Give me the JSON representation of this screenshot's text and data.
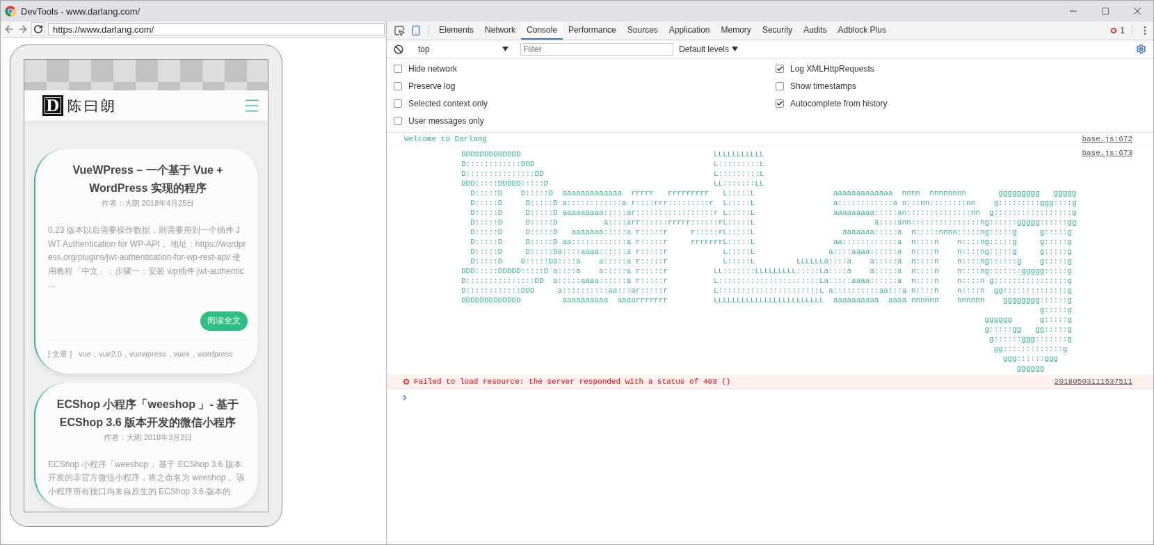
{
  "window": {
    "title": "DevTools - www.darlang.com/"
  },
  "browser": {
    "url": "https://www.darlang.com/"
  },
  "site": {
    "logo_mark": "D",
    "logo_text": "陈曰朗",
    "posts": [
      {
        "title": "VueWPress – 一个基于 Vue + WordPress 实现的程序",
        "meta": "作者：大朗 2018年4月25日",
        "excerpt": "0.23 版本以后需要操作数据，则需要用到一个插件 JWT Authentication for WP-API 。地址：https://wordpress.org/plugins/jwt-authentication-for-wp-rest-api/   使用教程「中文」：步骤一：安装 wp插件 jwt-authentic ...",
        "button": "阅读全文",
        "category": "[ 文章 ]",
        "tags": "vue，vue2.0，vuewpress，vuex，wordpress"
      },
      {
        "title": "ECShop 小程序「weeshop 」- 基于 ECShop 3.6 版本开发的微信小程序",
        "meta": "作者：大朗 2018年3月2日",
        "excerpt": "ECShop 小程序「weeshop 」基于 ECShop 3.6 版本开发的非官方微信小程序，将之命名为 weeshop 。该小程序所有接口均来自原生的 ECShop 3.6 版本的"
      }
    ]
  },
  "devtools": {
    "tabs": [
      {
        "label": "Elements",
        "selected": false
      },
      {
        "label": "Network",
        "selected": false
      },
      {
        "label": "Console",
        "selected": true
      },
      {
        "label": "Performance",
        "selected": false
      },
      {
        "label": "Sources",
        "selected": false
      },
      {
        "label": "Application",
        "selected": false
      },
      {
        "label": "Memory",
        "selected": false
      },
      {
        "label": "Security",
        "selected": false
      },
      {
        "label": "Audits",
        "selected": false
      },
      {
        "label": "Adblock Plus",
        "selected": false
      }
    ],
    "error_count": "1",
    "toolbar": {
      "context": "top",
      "filter_placeholder": "Filter",
      "levels": "Default levels"
    },
    "settings": [
      {
        "label": "Hide network",
        "checked": false
      },
      {
        "label": "Log XMLHttpRequests",
        "checked": true
      },
      {
        "label": "Preserve log",
        "checked": false
      },
      {
        "label": "Show timestamps",
        "checked": false
      },
      {
        "label": "Selected context only",
        "checked": false
      },
      {
        "label": "Autocomplete from history",
        "checked": true
      },
      {
        "label": "User messages only",
        "checked": false
      }
    ],
    "messages": [
      {
        "kind": "log",
        "text": "Welcome to Darlang",
        "source": "base.js:672"
      },
      {
        "kind": "art",
        "source": "base.js:673",
        "lines": [
          "DDDDDDDDDDDDD                                          LLLLLLLLLLL",
          "D::::::::::::DDD                                       L:::::::::L",
          "D:::::::::::::::DD                                     L:::::::::L",
          "DDD:::::DDDDD:::::D                                    LL:::::::LL",
          "  D:::::D    D:::::D  aaaaaaaaaaaaa  rrrrr   rrrrrrrrr   L:::::L                 aaaaaaaaaaaaa  nnnn  nnnnnnnn       ggggggggg   ggggg",
          "  D:::::D     D:::::D a::::::::::::a r::::rrr:::::::::r  L:::::L                 a::::::::::::a n:::nn::::::::nn    g:::::::::ggg::::g",
          "  D:::::D     D:::::D aaaaaaaaa:::::ar:::::::::::::::::r L:::::L                 aaaaaaaaa:::::an::::::::::::::nn  g:::::::::::::::::g",
          "  D:::::D     D:::::D          a::::arr::::::rrrrr::::::rL:::::L                          a::::ann:::::::::::::::ng::::::ggggg::::::gg",
          "  D:::::D     D:::::D   aaaaaaa:::::a r:::::r     r:::::rL:::::L                   aaaaaaa:::::a  n:::::nnnn:::::ng:::::g     g:::::g",
          "  D:::::D     D:::::D aa::::::::::::a r:::::r     rrrrrrrL:::::L                 aa::::::::::::a  n::::n    n::::ng:::::g     g:::::g",
          "  D:::::D     D:::::Da::::aaaa::::::a r:::::r            L:::::L                a::::aaaa::::::a  n::::n    n::::ng:::::g     g:::::g",
          "  D:::::D    D:::::Da::::a    a:::::a r:::::r            L:::::L         LLLLLLa::::a    a:::::a  n::::n    n::::ng::::::g    g:::::g",
          "DDD:::::DDDDD:::::D a::::a    a:::::a r:::::r          LL:::::::LLLLLLLLL:::::La::::a    a:::::a  n::::n    n::::ng:::::::ggggg:::::g",
          "D:::::::::::::::DD  a:::::aaaa::::::a r:::::r          L::::::::::::::::::::::La:::::aaaa::::::a  n::::n    n::::n g::::::::::::::::g",
          "D::::::::::::DDD     a::::::::::aa:::ar:::::r          L::::::::::::::::::::::L a::::::::::aa:::a n::::n    n::::n  gg::::::::::::::g",
          "DDDDDDDDDDDDD         aaaaaaaaaa  aaaarrrrrrr          LLLLLLLLLLLLLLLLLLLLLLLL  aaaaaaaaaa  aaaa nnnnnn    nnnnnn    gggggggg::::::g",
          "                                                                                                                              g:::::g",
          "                                                                                                                  gggggg      g:::::g",
          "                                                                                                                  g:::::gg   gg:::::g",
          "                                                                                                                   g::::::ggg:::::::g",
          "                                                                                                                    gg:::::::::::::g",
          "                                                                                                                      ggg::::::ggg",
          "                                                                                                                         gggggg"
        ]
      },
      {
        "kind": "error",
        "text": "Failed to load resource: the server responded with a status of 403 ()",
        "source": "20180503111537511"
      }
    ]
  }
}
